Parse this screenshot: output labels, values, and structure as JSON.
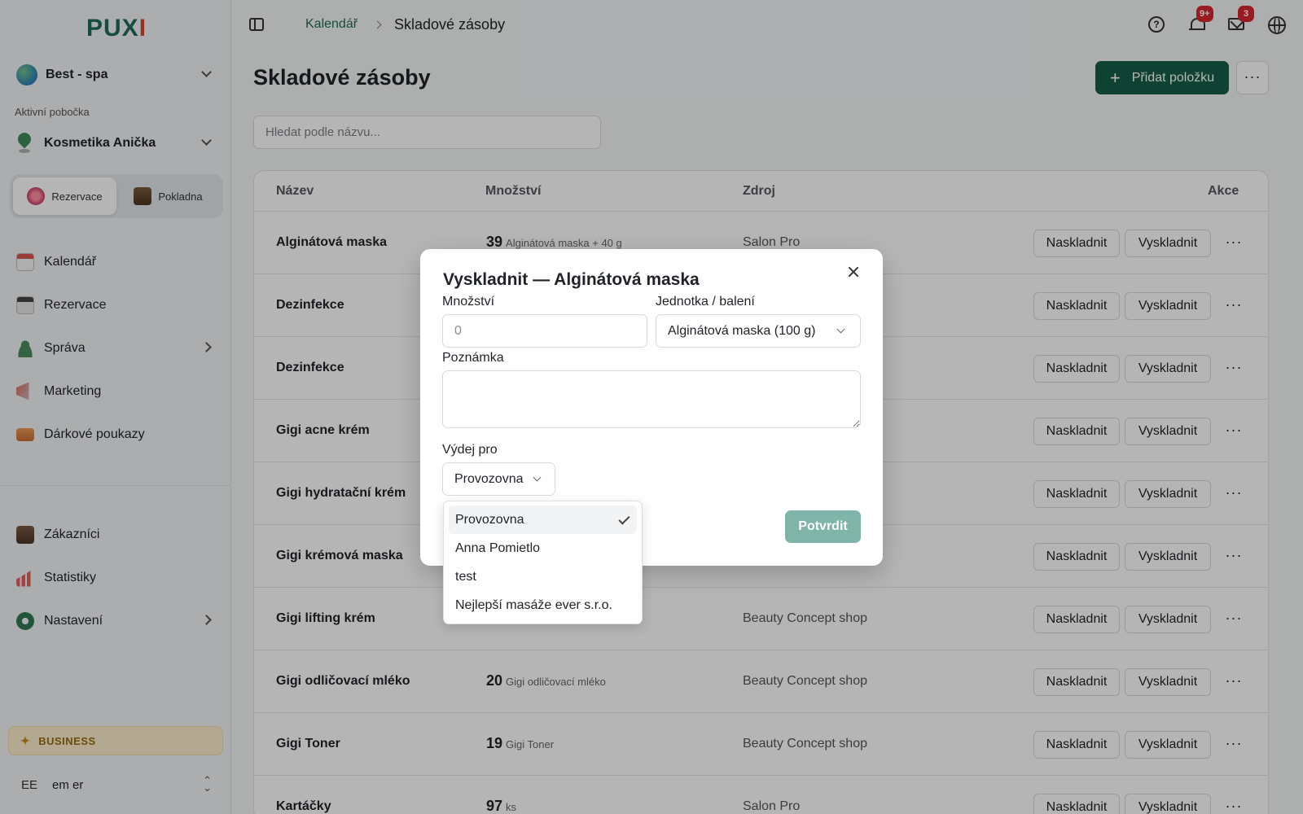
{
  "sidebar": {
    "logo": "PUX",
    "logo_accent": "I",
    "org": "Best - spa",
    "branch_label": "Aktivní pobočka",
    "branch": "Kosmetika Anička",
    "modes": [
      {
        "label": "Rezervace",
        "active": true
      },
      {
        "label": "Pokladna",
        "active": false
      }
    ],
    "nav": [
      {
        "label": "Kalendář",
        "icon": "calendar-icon"
      },
      {
        "label": "Rezervace",
        "icon": "reservations-icon"
      },
      {
        "label": "Správa",
        "icon": "user-icon",
        "has_submenu": true
      },
      {
        "label": "Marketing",
        "icon": "megaphone-icon"
      },
      {
        "label": "Dárkové poukazy",
        "icon": "gift-voucher-icon"
      }
    ],
    "nav2": [
      {
        "label": "Zákazníci",
        "icon": "customers-icon"
      },
      {
        "label": "Statistiky",
        "icon": "statistics-icon"
      },
      {
        "label": "Nastavení",
        "icon": "settings-icon",
        "has_submenu": true
      }
    ],
    "plan": "BUSINESS",
    "user_initials": "EE",
    "user_name": "em er"
  },
  "topbar": {
    "breadcrumb_link": "Kalendář",
    "breadcrumb_current": "Skladové zásoby",
    "notifications_badge": "9+",
    "messages_badge": "3"
  },
  "main": {
    "title": "Skladové zásoby",
    "add_button": "Přidat položku",
    "more_button": "···",
    "search_placeholder": "Hledat podle názvu..."
  },
  "table": {
    "columns": {
      "name": "Název",
      "qty": "Množství",
      "source": "Zdroj",
      "actions": "Akce"
    },
    "btn_in": "Naskladnit",
    "btn_out": "Vyskladnit",
    "row_more": "···",
    "rows": [
      {
        "name": "Alginátová maska",
        "qty": "39",
        "unit": "Alginátová maska + 40 g",
        "source": "Salon Pro"
      },
      {
        "name": "Dezinfekce",
        "qty": "",
        "unit": "",
        "source": ""
      },
      {
        "name": "Dezinfekce",
        "qty": "",
        "unit": "",
        "source": ""
      },
      {
        "name": "Gigi acne krém",
        "qty": "",
        "unit": "",
        "source": ""
      },
      {
        "name": "Gigi hydratační krém",
        "qty": "",
        "unit": "",
        "source": ""
      },
      {
        "name": "Gigi krémová maska",
        "qty": "",
        "unit": "",
        "source": ""
      },
      {
        "name": "Gigi lifting krém",
        "qty": "",
        "unit": "",
        "source": "Beauty Concept shop"
      },
      {
        "name": "Gigi odličovací mléko",
        "qty": "20",
        "unit": "Gigi odličovací mléko",
        "source": "Beauty Concept shop"
      },
      {
        "name": "Gigi Toner",
        "qty": "19",
        "unit": "Gigi Toner",
        "source": "Beauty Concept shop"
      },
      {
        "name": "Kartáčky",
        "qty": "97",
        "unit": "ks",
        "source": "Salon Pro"
      }
    ]
  },
  "modal": {
    "title": "Vyskladnit — Alginátová maska",
    "qty_label": "Množství",
    "qty_placeholder": "0",
    "unit_label": "Jednotka / balení",
    "unit_value": "Alginátová maska (100 g)",
    "note_label": "Poznámka",
    "for_label": "Výdej pro",
    "for_value": "Provozovna",
    "confirm": "Potvrdit",
    "options": [
      {
        "label": "Provozovna",
        "selected": true
      },
      {
        "label": "Anna Pomietlo",
        "selected": false
      },
      {
        "label": "test",
        "selected": false
      },
      {
        "label": "Nejlepší masáže ever s.r.o.",
        "selected": false
      }
    ]
  },
  "colors": {
    "brand": "#175d4a",
    "brand_disabled": "#7fb5a8",
    "badge": "#d9262c",
    "business": "#fbeecb"
  }
}
